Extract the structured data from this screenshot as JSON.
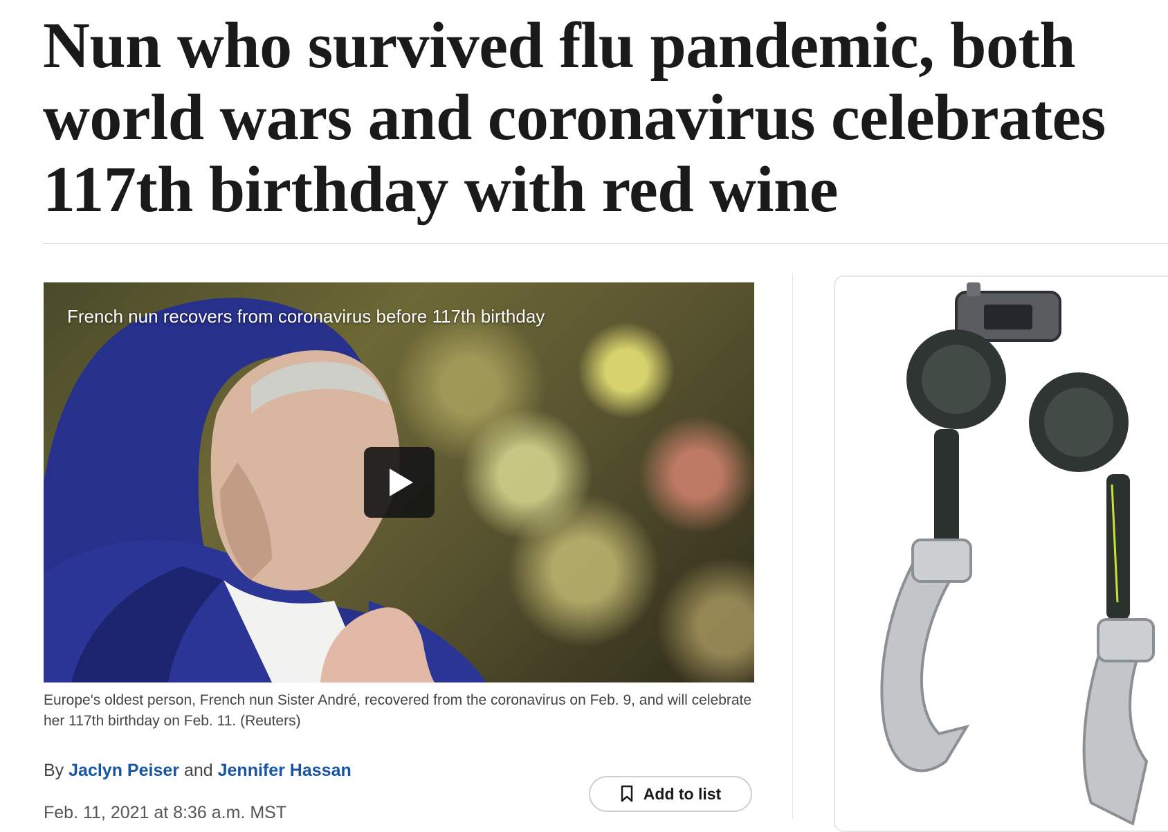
{
  "article": {
    "headline": "Nun who survived flu pandemic, both world wars and coronavirus celebrates 117th birthday with red wine",
    "video": {
      "title": "French nun recovers from coronavirus before 117th birthday"
    },
    "caption": "Europe's oldest person, French nun Sister André, recovered from the coronavirus on Feb. 9, and will celebrate her 117th birthday on Feb. 11. (Reuters)",
    "byline": {
      "prefix": "By",
      "author1": "Jaclyn Peiser",
      "conjunction": "and",
      "author2": "Jennifer Hassan"
    },
    "date": "Feb. 11, 2021 at 8:36 a.m. MST",
    "add_to_list_label": "Add to list"
  },
  "icons": {
    "play": "play-icon",
    "bookmark": "bookmark-icon"
  },
  "colors": {
    "link": "#1955a5",
    "headline": "#1a1a1a"
  }
}
